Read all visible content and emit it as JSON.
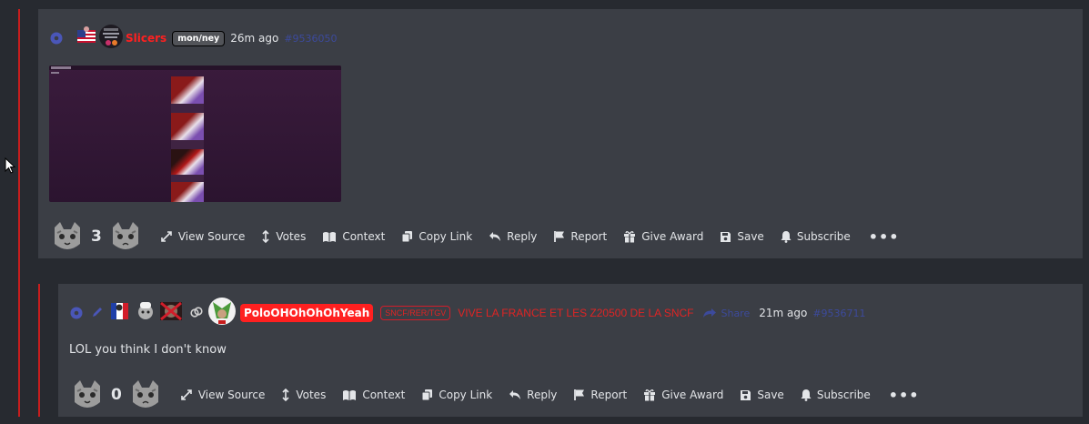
{
  "comment1": {
    "username": "Slicers",
    "flair": "mon/ney",
    "time": "26m ago",
    "post_id": "#9536050",
    "score": "3"
  },
  "comment2": {
    "username": "PoloOHOhOhOhYeah",
    "badge": "SNCF/RER/TGV",
    "custom_title": "VIVE LA FRANCE ET LES Z20500 DE LA SNCF",
    "share_label": "Share",
    "time": "21m ago",
    "post_id": "#9536711",
    "body": "LOL you think I don't know",
    "score": "0"
  },
  "actions": {
    "view_source": "View Source",
    "votes": "Votes",
    "context": "Context",
    "copy_link": "Copy Link",
    "reply": "Reply",
    "report": "Report",
    "give_award": "Give Award",
    "save": "Save",
    "subscribe": "Subscribe",
    "more": "•••"
  },
  "colors": {
    "thread_line": "#c81d1d",
    "username": "#ff2020",
    "card_bg": "#3b3e45",
    "page_bg": "#272a30",
    "link_blue": "#3c4a9c"
  }
}
